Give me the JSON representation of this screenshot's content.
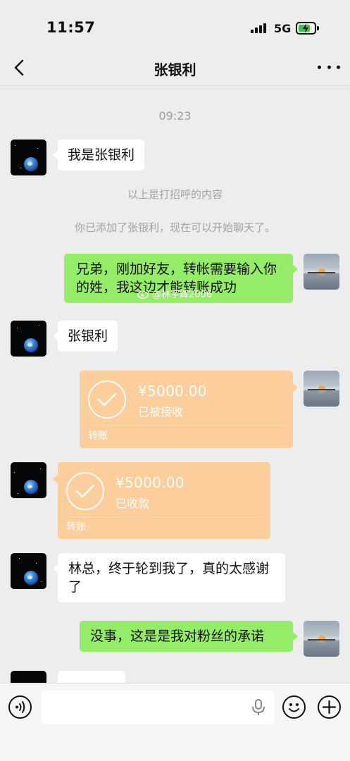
{
  "status_bar": {
    "time": "11:57",
    "network": "5G"
  },
  "nav": {
    "title": "张银利"
  },
  "chat": {
    "timestamp": "09:23",
    "greeting_message": "我是张银利",
    "system_notes": [
      "以上是打招呼的内容",
      "你已添加了张银利，现在可以开始聊天了。"
    ],
    "outgoing_message_1": "兄弟，刚加好友，转帐需要输入你的姓，我这边才能转账成功",
    "incoming_message_2": "张银利",
    "transfer_out": {
      "amount": "¥5000.00",
      "status": "已被接收",
      "label": "转账"
    },
    "transfer_in": {
      "amount": "¥5000.00",
      "status": "已收款",
      "label": "转账"
    },
    "incoming_message_3": "林总，终于轮到我了，真的太感谢了",
    "outgoing_message_4": "没事，这是是我对粉丝的承诺"
  },
  "watermark": "@林宇辉2006",
  "colors": {
    "outgoing_bubble": "#95ec69",
    "transfer_card": "#fbce9c",
    "background": "#ededed"
  },
  "icons": [
    "back-icon",
    "more-icon",
    "voice-icon",
    "mic-icon",
    "emoji-icon",
    "add-icon",
    "check-icon",
    "weibo-icon"
  ]
}
